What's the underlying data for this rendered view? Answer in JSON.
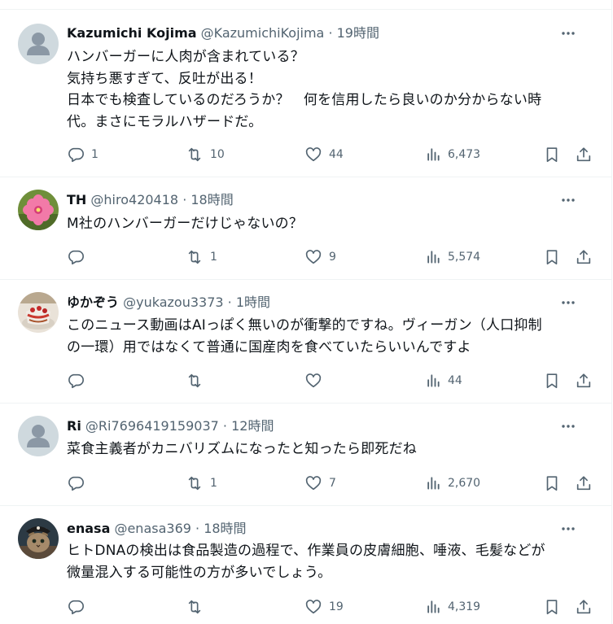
{
  "tweets": [
    {
      "name": "Kazumichi Kojima",
      "handle": "@KazumichiKojima",
      "time": "· 19時間",
      "lines": [
        "ハンバーガーに人肉が含まれている？",
        "気持ち悪すぎて、反吐が出る！",
        "日本でも検査しているのだろうか？　何を信用したら良いのか分からない時",
        "代。まさにモラルハザードだ。"
      ],
      "replies": "1",
      "retweets": "10",
      "likes": "44",
      "views": "6,473",
      "avatar": "default-avatar"
    },
    {
      "name": "TH",
      "handle": "@hiro420418",
      "time": "· 18時間",
      "lines": [
        "M社のハンバーガーだけじゃないの？"
      ],
      "replies": "",
      "retweets": "1",
      "likes": "9",
      "views": "5,574",
      "avatar": "pink-flower-avatar"
    },
    {
      "name": "ゆかぞう",
      "handle": "@yukazou3373",
      "time": "· 1時間",
      "lines": [
        "このニュース動画はAIっぽく無いのが衝撃的ですね。ヴィーガン（人口抑制",
        "の一環）用ではなくて普通に国産肉を食べていたらいいんですよ"
      ],
      "replies": "",
      "retweets": "",
      "likes": "",
      "views": "44",
      "avatar": "cake-avatar"
    },
    {
      "name": "Ri",
      "handle": "@Ri7696419159037",
      "time": "· 12時間",
      "lines": [
        "菜食主義者がカニバリズムになったと知ったら即死だね"
      ],
      "replies": "",
      "retweets": "1",
      "likes": "7",
      "views": "2,670",
      "avatar": "default-avatar"
    },
    {
      "name": "enasa",
      "handle": "@enasa369",
      "time": "· 18時間",
      "lines": [
        "ヒトDNAの検出は食品製造の過程で、作業員の皮膚細胞、唾液、毛髪などが",
        "微量混入する可能性の方が多いでしょう。"
      ],
      "replies": "",
      "retweets": "",
      "likes": "19",
      "views": "4,319",
      "avatar": "pirate-cat-avatar"
    }
  ],
  "colors": {
    "text": "#0f1419",
    "secondary": "#536471",
    "divider": "#eff3f4",
    "avatar_default": "#cfd9de"
  }
}
